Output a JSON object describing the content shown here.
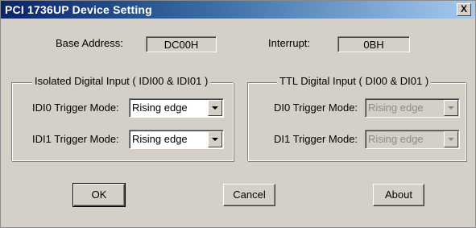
{
  "window": {
    "title": "PCI 1736UP Device Setting",
    "close_glyph": "X",
    "titlebar_color_start": "#0a246a",
    "titlebar_color_end": "#a6caf0"
  },
  "base_address": {
    "label": "Base Address:",
    "value": "DC00H"
  },
  "interrupt": {
    "label": "Interrupt:",
    "value": "0BH"
  },
  "isolated_group": {
    "legend": "Isolated Digital Input ( IDI00 & IDI01 )",
    "rows": [
      {
        "label": "IDI0 Trigger Mode:",
        "value": "Rising edge"
      },
      {
        "label": "IDI1 Trigger Mode:",
        "value": "Rising edge"
      }
    ]
  },
  "ttl_group": {
    "legend": "TTL Digital Input ( DI00 & DI01 )",
    "rows": [
      {
        "label": "DI0 Trigger Mode:",
        "value": "Rising edge"
      },
      {
        "label": "DI1 Trigger Mode:",
        "value": "Rising edge"
      }
    ]
  },
  "buttons": {
    "ok": "OK",
    "cancel": "Cancel",
    "about": "About"
  }
}
